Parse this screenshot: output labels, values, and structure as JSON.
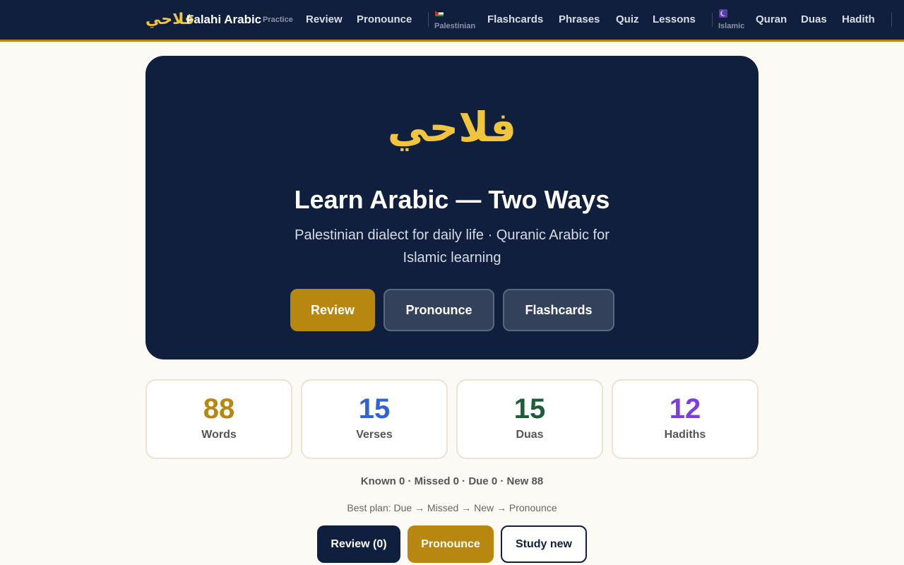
{
  "nav": {
    "brand_arabic": "فلاحي",
    "brand_name": "Falahi Arabic",
    "practice_label": "Practice",
    "practice_links": [
      "Review",
      "Pronounce"
    ],
    "palestinian_label": "Palestinian",
    "palestinian_links": [
      "Flashcards",
      "Phrases",
      "Quiz",
      "Lessons"
    ],
    "islamic_label": "Islamic",
    "islamic_links": [
      "Quran",
      "Duas",
      "Hadith"
    ]
  },
  "hero": {
    "arabic": "فلاحي",
    "title": "Learn Arabic — Two Ways",
    "subtitle": "Palestinian dialect for daily life · Quranic Arabic for Islamic learning",
    "buttons": [
      "Review",
      "Pronounce",
      "Flashcards"
    ]
  },
  "stats": [
    {
      "value": "88",
      "label": "Words",
      "color": "#b7870f"
    },
    {
      "value": "15",
      "label": "Verses",
      "color": "#2f63d6"
    },
    {
      "value": "15",
      "label": "Duas",
      "color": "#1e5c3a"
    },
    {
      "value": "12",
      "label": "Hadiths",
      "color": "#7b3fe0"
    }
  ],
  "progress": "Known 0 · Missed 0 · Due 0 · New 88",
  "plan": "Best plan: Due → Missed → New → Pronounce",
  "actions": [
    "Review (0)",
    "Pronounce",
    "Study new"
  ],
  "colors": {
    "navy": "#0f1f3d",
    "gold": "#b7870f",
    "accent_arabic": "#f0c43c"
  }
}
